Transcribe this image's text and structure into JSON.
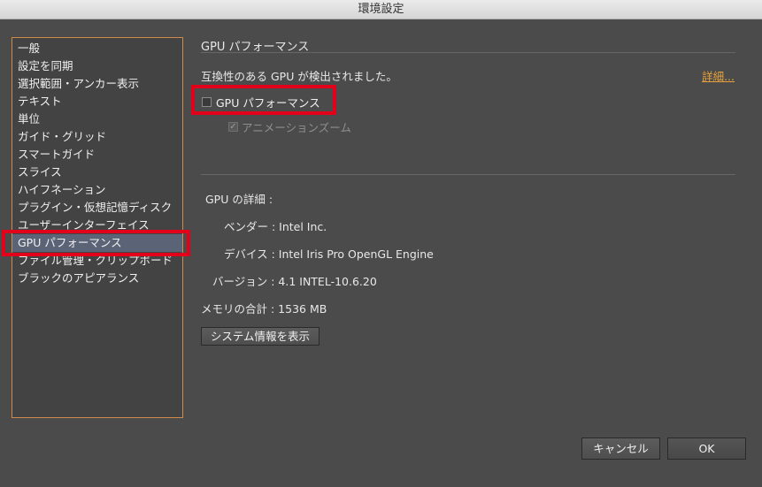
{
  "window": {
    "title": "環境設定"
  },
  "sidebar": {
    "items": [
      {
        "label": "一般"
      },
      {
        "label": "設定を同期"
      },
      {
        "label": "選択範囲・アンカー表示"
      },
      {
        "label": "テキスト"
      },
      {
        "label": "単位"
      },
      {
        "label": "ガイド・グリッド"
      },
      {
        "label": "スマートガイド"
      },
      {
        "label": "スライス"
      },
      {
        "label": "ハイフネーション"
      },
      {
        "label": "プラグイン・仮想記憶ディスク"
      },
      {
        "label": "ユーザーインターフェイス"
      },
      {
        "label": "GPU パフォーマンス"
      },
      {
        "label": "ファイル管理・クリップボード"
      },
      {
        "label": "ブラックのアピアランス"
      }
    ],
    "selected_index": 11
  },
  "main": {
    "section_title": "GPU パフォーマンス",
    "detected_text": "互換性のある GPU が検出されました。",
    "details_link": "詳細...",
    "gpu_checkbox": {
      "label": "GPU パフォーマンス",
      "checked": false
    },
    "animation_checkbox": {
      "label": "アニメーションズーム",
      "checked": true,
      "disabled": true
    },
    "gpu_details": {
      "heading": "GPU の詳細 :",
      "vendor": "ベンダー : Intel Inc.",
      "device": "デバイス : Intel Iris Pro OpenGL Engine",
      "version": "バージョン : 4.1 INTEL-10.6.20",
      "memory": "メモリの合計 : 1536 MB"
    },
    "system_info_button": "システム情報を表示"
  },
  "footer": {
    "cancel_label": "キャンセル",
    "ok_label": "OK"
  },
  "colors": {
    "highlight_box": "#e3001b",
    "link": "#e6a23c",
    "selection": "#5b6476"
  }
}
